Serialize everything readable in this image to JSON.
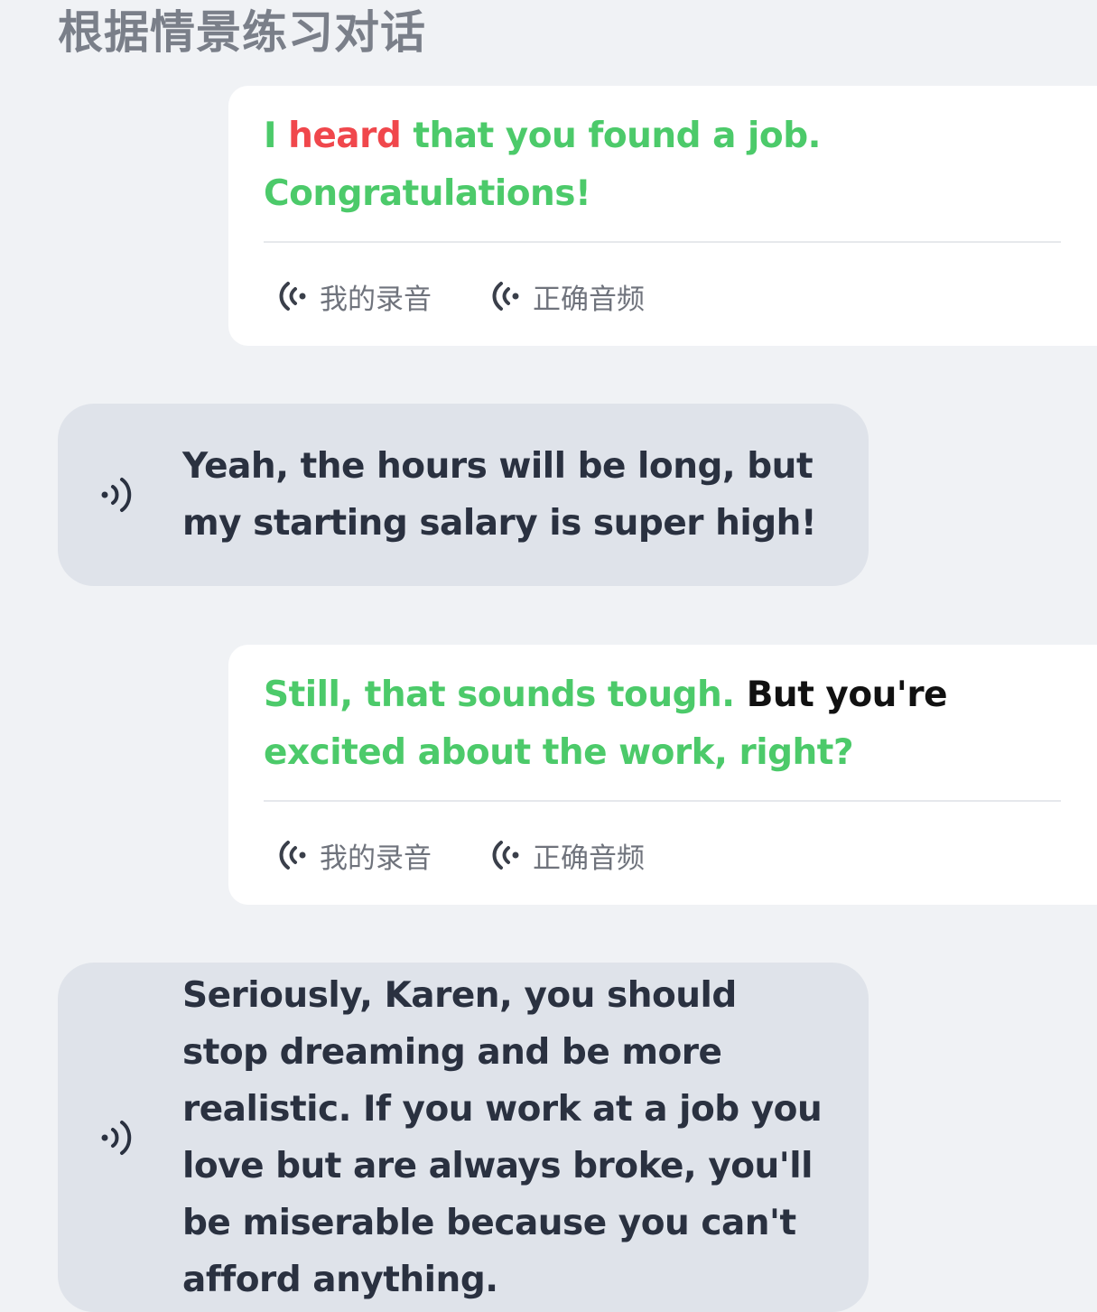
{
  "page_title": "根据情景练习对话",
  "labels": {
    "my_recording": "我的录音",
    "correct_audio": "正确音频"
  },
  "colors": {
    "correct": "#4cca6a",
    "incorrect": "#f0474c",
    "neutral": "#111111",
    "partner_bubble": "#dfe3ea",
    "page_background": "#f0f2f5"
  },
  "icons": {
    "recording": "sound-wave-left-icon",
    "speaker": "speaker-wave-icon"
  },
  "dialogue": [
    {
      "role": "user",
      "segments": [
        {
          "text": "I ",
          "status": "correct"
        },
        {
          "text": "heard",
          "status": "incorrect"
        },
        {
          "text": " that you found a job. Congratulations!",
          "status": "correct"
        }
      ]
    },
    {
      "role": "partner",
      "text": "Yeah, the hours will be long, but my starting salary is super high!"
    },
    {
      "role": "user",
      "segments": [
        {
          "text": "Still, that sounds tough. ",
          "status": "correct"
        },
        {
          "text": "But you're",
          "status": "neutral"
        },
        {
          "text": " excited about the work, right?",
          "status": "correct"
        }
      ]
    },
    {
      "role": "partner",
      "text": "Seriously, Karen, you should stop dreaming and be more realistic. If you work at a job you love but are always broke, you'll be miserable because you can't afford anything."
    }
  ]
}
